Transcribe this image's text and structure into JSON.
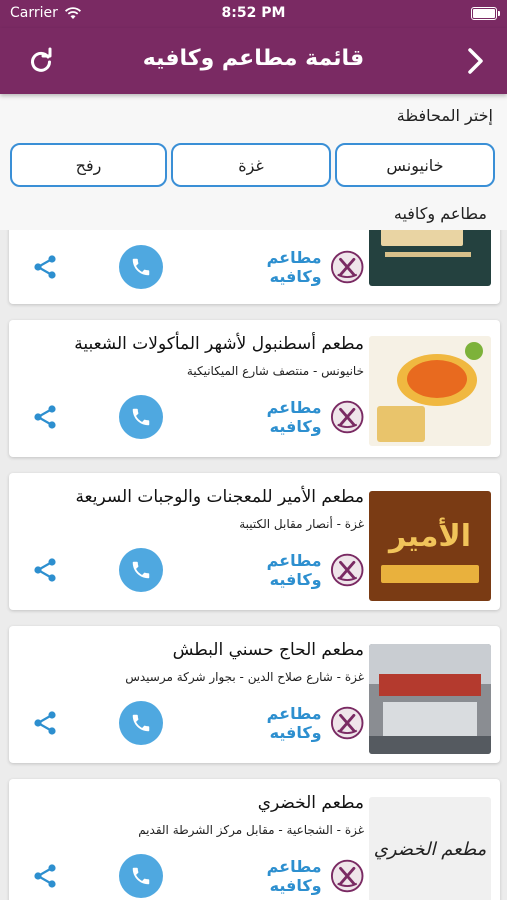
{
  "status_bar": {
    "carrier": "Carrier",
    "time": "8:52 PM"
  },
  "nav": {
    "title": "قائمة مطاعم وكافيه"
  },
  "filter": {
    "label": "إختر المحافظة",
    "chips": [
      "خانيونس",
      "غزة",
      "رفح"
    ],
    "section_title": "مطاعم وكافيه"
  },
  "restaurants": [
    {
      "name": "",
      "address": "",
      "category": "مطاعم وكافيه",
      "thumb_text": ""
    },
    {
      "name": "مطعم أسطنبول لأشهر المأكولات الشعبية",
      "address": "خانيونس - منتصف شارع الميكانيكية",
      "category": "مطاعم وكافيه",
      "thumb_text": ""
    },
    {
      "name": "مطعم الأمير للمعجنات والوجبات السريعة",
      "address": "غزة - أنصار مقابل الكتيبة",
      "category": "مطاعم وكافيه",
      "thumb_text": "الأمير"
    },
    {
      "name": "مطعم الحاج حسني البطش",
      "address": "غزة - شارع صلاح الدين - بجوار شركة مرسيدس",
      "category": "مطاعم وكافيه",
      "thumb_text": ""
    },
    {
      "name": "مطعم الخضري",
      "address": "غزة - الشجاعية - مقابل مركز الشرطة القديم",
      "category": "مطاعم وكافيه",
      "thumb_text": "مطعم الخضري"
    }
  ],
  "colors": {
    "header": "#7a2a63",
    "chip_border": "#3a8fd6",
    "call_button": "#4fa8e0",
    "category_text": "#2d8fcf"
  },
  "icons": {
    "refresh": "refresh-icon",
    "back": "chevron-right-icon",
    "call": "phone-icon",
    "share": "share-icon",
    "category": "restaurant-badge-icon"
  }
}
